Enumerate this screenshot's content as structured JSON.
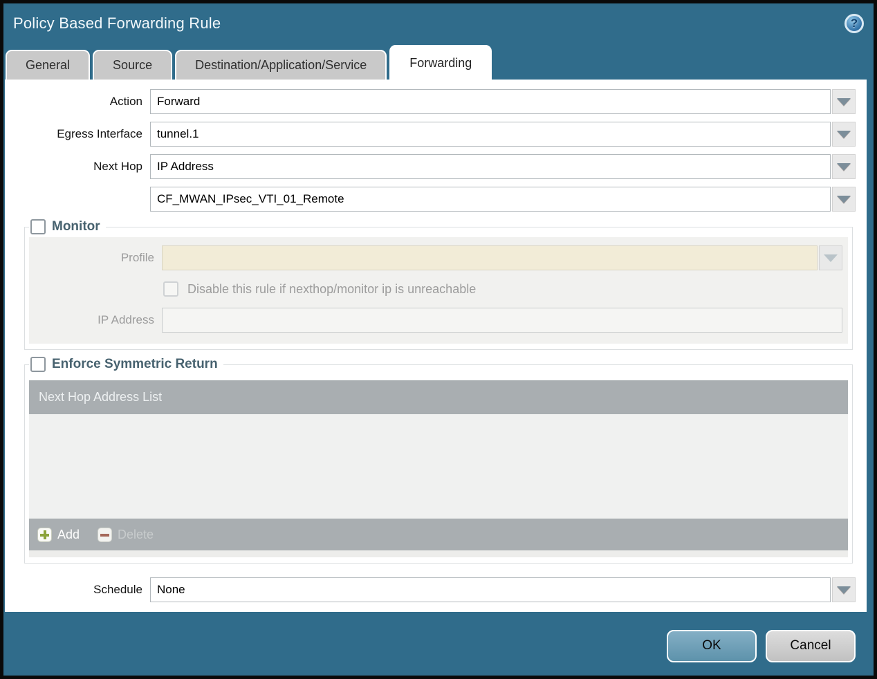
{
  "dialog": {
    "title": "Policy Based Forwarding Rule",
    "help_glyph": "?"
  },
  "icons": {
    "help": "question-mark-circle",
    "dropdown": "down-arrow-triangle",
    "add": "green-plus",
    "delete": "red-minus"
  },
  "tabs": [
    {
      "label": "General",
      "active": false
    },
    {
      "label": "Source",
      "active": false
    },
    {
      "label": "Destination/Application/Service",
      "active": false
    },
    {
      "label": "Forwarding",
      "active": true
    }
  ],
  "form": {
    "action": {
      "label": "Action",
      "value": "Forward"
    },
    "egress_interface": {
      "label": "Egress Interface",
      "value": "tunnel.1"
    },
    "next_hop": {
      "label": "Next Hop",
      "value": "IP Address"
    },
    "next_hop_address": {
      "value": "CF_MWAN_IPsec_VTI_01_Remote"
    },
    "schedule": {
      "label": "Schedule",
      "value": "None"
    }
  },
  "monitor": {
    "legend": "Monitor",
    "checked": false,
    "profile": {
      "label": "Profile",
      "value": ""
    },
    "disable_rule": {
      "label": "Disable this rule if nexthop/monitor ip is unreachable",
      "checked": false
    },
    "ip_address": {
      "label": "IP Address",
      "value": ""
    }
  },
  "enforce_symmetric_return": {
    "legend": "Enforce Symmetric Return",
    "checked": false,
    "table": {
      "header": "Next Hop Address List",
      "rows": []
    },
    "add_label": "Add",
    "delete_label": "Delete"
  },
  "footer": {
    "ok_label": "OK",
    "cancel_label": "Cancel"
  },
  "colors": {
    "frame_teal": "#306c8b",
    "inactive_tab": "#c9c9c9",
    "disabled_field_bg": "#f2ecd7",
    "panel_gray": "#f1f1ef",
    "table_chrome": "#a9aeb1",
    "ok_button": "#6f9fb7",
    "cancel_button": "#cfcfcf",
    "add_plus_green": "#8ca33b",
    "delete_minus_red": "#a5685a",
    "legend_text": "#47626f"
  }
}
